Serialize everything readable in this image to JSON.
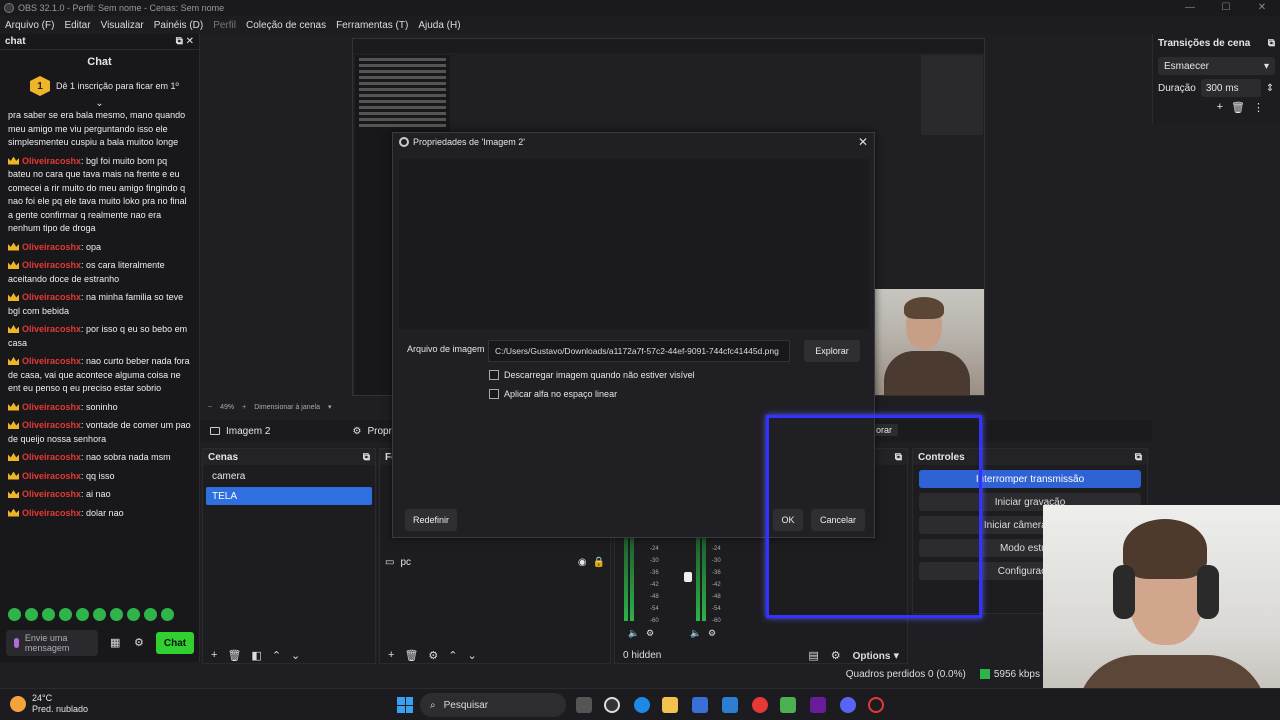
{
  "window": {
    "title": "OBS 32.1.0 - Perfil: Sem nome - Cenas: Sem nome",
    "controls": [
      "—",
      "☐",
      "✕"
    ]
  },
  "menu": [
    "Arquivo (F)",
    "Editar",
    "Visualizar",
    "Painéis (D)",
    "Perfil",
    "Coleção de cenas",
    "Ferramentas (T)",
    "Ajuda (H)"
  ],
  "chat": {
    "dock_title": "chat",
    "title": "Chat",
    "sub_banner": "Dê 1 inscrição para ficar em 1º",
    "sub_badge": "1",
    "messages": [
      {
        "user": "",
        "text": "pra saber se era bala mesmo, mano quando meu amigo me viu perguntando isso ele simplesmenteu cuspiu a bala muitoo longe"
      },
      {
        "user": "Oliveiracoshx",
        "text": ": bgl foi muito bom pq bateu no cara que tava mais na frente e eu comecei a rir muito do meu amigo fingindo q nao foi ele pq ele tava muito loko pra no final a gente confirmar q realmente nao era nenhum tipo de droga"
      },
      {
        "user": "Oliveiracoshx",
        "text": ": opa"
      },
      {
        "user": "Oliveiracoshx",
        "text": ": os cara literalmente aceitando doce de estranho"
      },
      {
        "user": "Oliveiracoshx",
        "text": ": na minha familia so teve bgl com bebida"
      },
      {
        "user": "Oliveiracoshx",
        "text": ": por isso q eu so bebo em casa"
      },
      {
        "user": "Oliveiracoshx",
        "text": ": nao curto beber nada fora de casa, vai que acontece alguma coisa ne ent eu penso q eu preciso estar sobrio"
      },
      {
        "user": "Oliveiracoshx",
        "text": ": soninho"
      },
      {
        "user": "Oliveiracoshx",
        "text": ": vontade de comer um pao de queijo nossa senhora"
      },
      {
        "user": "Oliveiracoshx",
        "text": ": nao sobra nada msm"
      },
      {
        "user": "Oliveiracoshx",
        "text": ": qq isso"
      },
      {
        "user": "Oliveiracoshx",
        "text": ": ai nao"
      },
      {
        "user": "Oliveiracoshx",
        "text": ": dolar nao"
      }
    ],
    "input_placeholder": "Envie uma mensagem",
    "send_label": "Chat"
  },
  "transitions": {
    "title": "Transições de cena",
    "selected": "Esmaecer",
    "duration_label": "Duração",
    "duration_value": "300 ms"
  },
  "preview_bar": {
    "zoom": "49%",
    "mode": "Dimensionar à janela"
  },
  "context_bar": {
    "source_name": "Imagem 2",
    "properties_label": "Propriedades",
    "filters_fragment": "orar"
  },
  "scenes": {
    "title": "Cenas",
    "items": [
      "camera",
      "TELA"
    ],
    "selected_index": 1
  },
  "sources": {
    "title": "Fo",
    "items": [
      "pc"
    ]
  },
  "controls": {
    "title": "Controles",
    "buttons": [
      "Interromper transmissão",
      "Iniciar gravação",
      "Iniciar câmera virtual",
      "Modo estúdio",
      "Configurações"
    ]
  },
  "mixer": {
    "ticks": [
      "-24",
      "-30",
      "-36",
      "-42",
      "-48",
      "-54",
      "-60"
    ],
    "hidden_label": "0 hidden",
    "options_label": "Options"
  },
  "status": {
    "dropped": "Quadros perdidos 0 (0.0%)",
    "bitrate": "5956 kbps"
  },
  "dialog": {
    "title": "Propriedades de 'Imagem 2'",
    "file_label": "Arquivo de imagem",
    "file_path": "C:/Users/Gustavo/Downloads/a1172a7f-57c2-44ef-9091-744cfc41445d.png",
    "browse_label": "Explorar",
    "check1": "Descarregar imagem quando não estiver visível",
    "check2": "Aplicar alfa no espaço linear",
    "reset_label": "Redefinir",
    "ok_label": "OK",
    "cancel_label": "Cancelar"
  },
  "taskbar": {
    "temperature": "24°C",
    "weather": "Pred. nublado",
    "search": "Pesquisar"
  }
}
